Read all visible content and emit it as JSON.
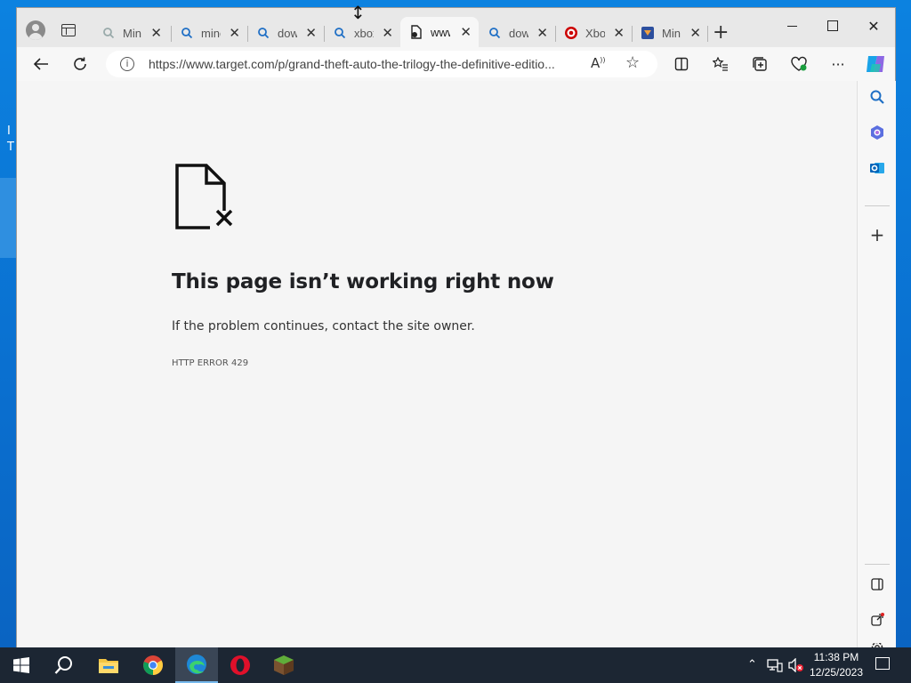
{
  "browser": {
    "tabs": [
      {
        "label": "Min",
        "icon": "search-icon-gray"
      },
      {
        "label": "mine",
        "icon": "search-icon"
      },
      {
        "label": "dow",
        "icon": "search-icon"
      },
      {
        "label": "xbox",
        "icon": "search-icon"
      },
      {
        "label": "www",
        "icon": "broken-page-icon",
        "active": true
      },
      {
        "label": "dow",
        "icon": "search-icon"
      },
      {
        "label": "Xbo",
        "icon": "target-logo-icon"
      },
      {
        "label": "Min",
        "icon": "app-logo-icon"
      }
    ],
    "address": {
      "url": "https://www.target.com/p/grand-theft-auto-the-trilogy-the-definitive-editio..."
    }
  },
  "error_page": {
    "title": "This page isn’t working right now",
    "message": "If the problem continues, contact the site owner.",
    "code": "HTTP ERROR 429"
  },
  "taskbar": {
    "clock_time": "11:38 PM",
    "clock_date": "12/25/2023"
  },
  "colors": {
    "accent": "#0a78d7",
    "taskbar": "#1c2633",
    "target_red": "#cc0000"
  }
}
